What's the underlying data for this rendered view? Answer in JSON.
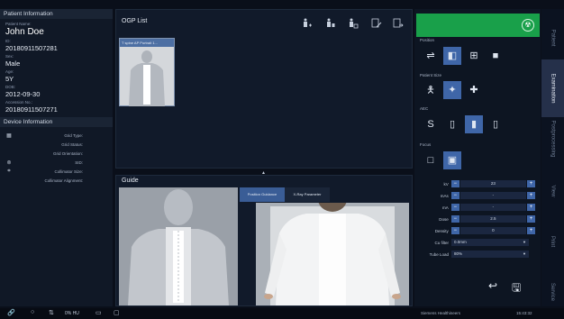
{
  "patient_panel": {
    "title": "Patient Information",
    "name_label": "Patient Name:",
    "name": "John Doe",
    "id_label": "ID:",
    "id": "20180911507281",
    "sex_label": "Sex:",
    "sex": "Male",
    "age_label": "Age:",
    "age": "5Y",
    "dob_label": "DOB:",
    "dob": "2012-09-30",
    "accession_label": "Accession No.:",
    "accession": "20180911507271"
  },
  "device_panel": {
    "title": "Device Information",
    "rows": [
      {
        "label": "Grid Type:",
        "value": ""
      },
      {
        "label": "Grid Status:",
        "value": ""
      },
      {
        "label": "Grid Orientation:",
        "value": ""
      },
      {
        "label": "SID:",
        "value": ""
      },
      {
        "label": "Collimator Size:",
        "value": ""
      },
      {
        "label": "Collimator Alignment:",
        "value": ""
      }
    ]
  },
  "ogp": {
    "title": "OGP List",
    "thumb_caption": "T spine AP Portrait 1...",
    "toolbar_icons": [
      "add-view-icon",
      "delete-view-icon",
      "copy-view-icon",
      "edit-view-icon",
      "exit-view-icon"
    ]
  },
  "guide": {
    "title": "Guide",
    "tabs": [
      "Position Guidance",
      "X-Ray Parameter"
    ]
  },
  "exam": {
    "position_label": "Position",
    "patient_size_label": "Patient Size",
    "aec_label": "AEC",
    "focus_label": "Focus",
    "params": [
      {
        "label": "kV",
        "value": "23"
      },
      {
        "label": "mAs",
        "value": "-"
      },
      {
        "label": "mA",
        "value": "-"
      },
      {
        "label": "Dose",
        "value": "2.5"
      },
      {
        "label": "Density",
        "value": "0"
      }
    ],
    "cu_filter_label": "Cu filter",
    "cu_filter_value": "0.0mm",
    "tube_load_label": "Tube Load",
    "tube_load_value": "80%",
    "minus": "−",
    "plus": "+",
    "caret": "▼"
  },
  "side_tabs": [
    "Patient",
    "Examination",
    "Postprocessing",
    "View",
    "Print",
    "Service"
  ],
  "status": {
    "hu_text": "0% HU",
    "user": "Siemens Healthineers",
    "time": "15:43:32"
  },
  "colors": {
    "accent": "#3f66a8",
    "green": "#19a04a"
  }
}
